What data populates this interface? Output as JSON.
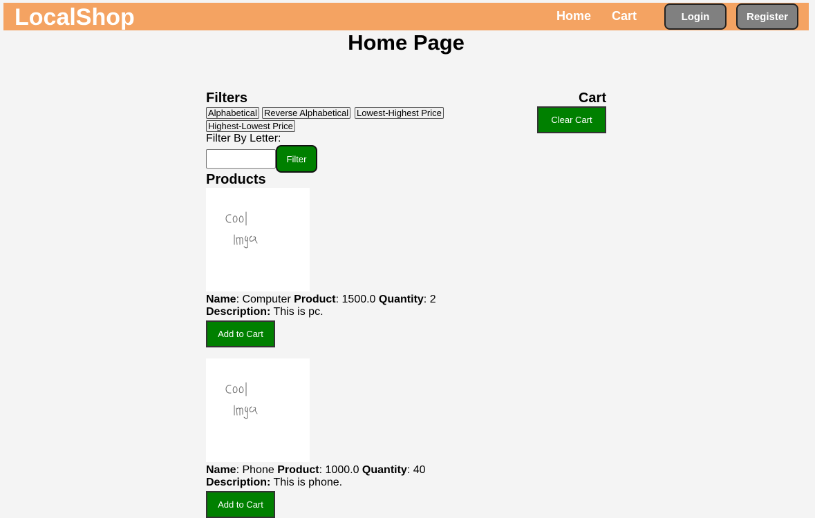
{
  "header": {
    "brand": "LocalShop",
    "nav": {
      "home": "Home",
      "cart": "Cart"
    },
    "login_label": "Login",
    "register_label": "Register"
  },
  "page_title": "Home Page",
  "filters": {
    "heading": "Filters",
    "options": [
      "Alphabetical",
      "Reverse Alphabetical",
      "Lowest-Highest Price",
      "Highest-Lowest Price"
    ],
    "letter_label": "Filter By Letter:",
    "letter_value": "",
    "filter_button": "Filter"
  },
  "cart": {
    "heading": "Cart",
    "clear_button": "Clear Cart"
  },
  "products": {
    "heading": "Products",
    "labels": {
      "name": "Name",
      "product": "Product",
      "quantity": "Quantity",
      "description": "Description:"
    },
    "image_text": "Cool Image",
    "add_button": "Add to Cart",
    "items": [
      {
        "name": "Computer",
        "price": "1500.0",
        "quantity": "2",
        "description": "This is pc."
      },
      {
        "name": "Phone",
        "price": "1000.0",
        "quantity": "40",
        "description": "This is phone."
      }
    ]
  },
  "colors": {
    "header_bg": "#f4a362",
    "accent_green": "#008000",
    "auth_button_bg": "#808080",
    "page_bg": "#f4f4f4"
  }
}
